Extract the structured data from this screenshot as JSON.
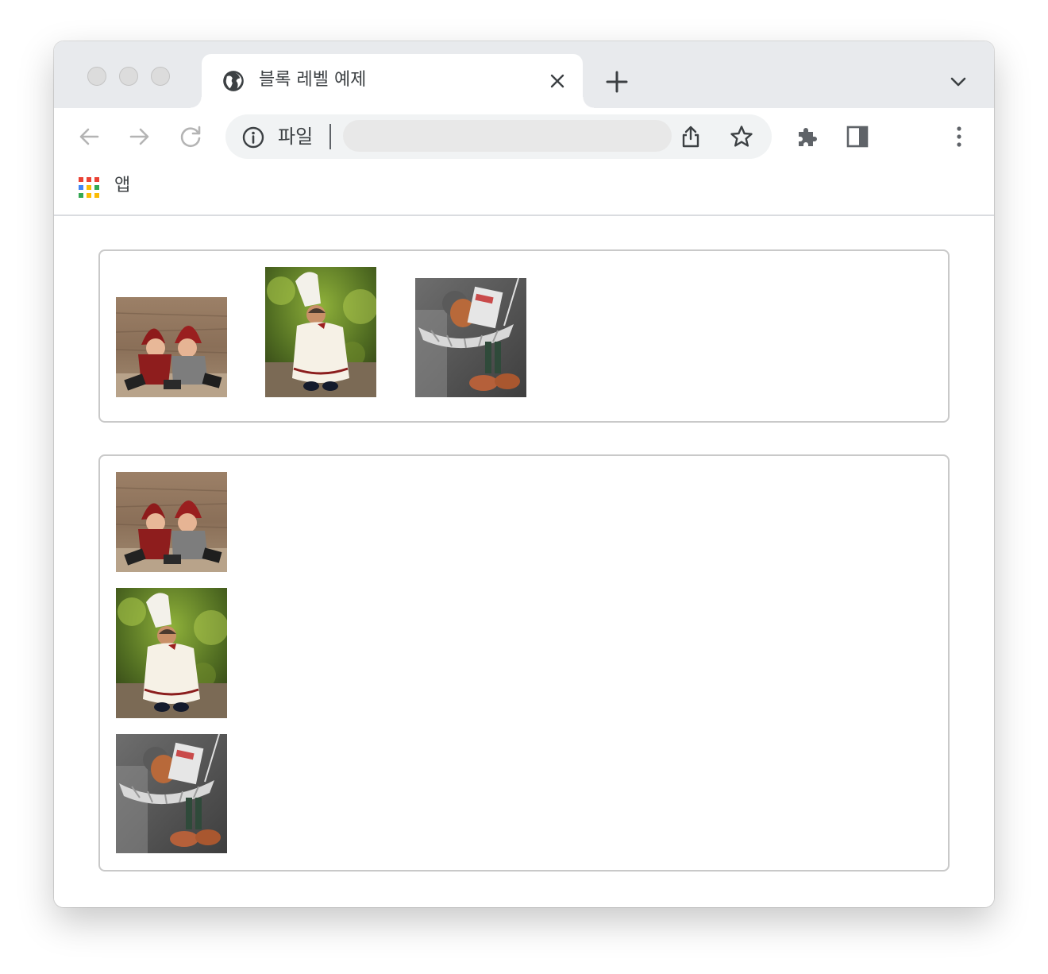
{
  "browser": {
    "tab": {
      "title": "블록 레벨 예제",
      "favicon": "globe-icon"
    },
    "address_bar": {
      "scheme_label": "파일",
      "url": ""
    },
    "bookmarks": {
      "apps_label": "앱"
    },
    "icons": {
      "back": "back-arrow-icon",
      "forward": "forward-arrow-icon",
      "reload": "reload-icon",
      "info": "info-icon",
      "share": "share-icon",
      "star": "star-icon",
      "extensions": "puzzle-icon",
      "side_panel": "side-panel-icon",
      "menu": "kebab-menu-icon",
      "new_tab": "plus-icon",
      "tab_search": "chevron-down-icon",
      "close_tab": "close-icon",
      "apps": "apps-grid-icon"
    },
    "colors": {
      "tabstrip": "#e8eaed",
      "omnibox": "#f1f3f4",
      "icon": "#5f6368",
      "icon_disabled": "#b4b4b4"
    }
  },
  "page": {
    "inline_group": {
      "images": [
        "gnome-couple",
        "chef-figurine",
        "reading-figurine"
      ]
    },
    "block_group": {
      "images": [
        "gnome-couple",
        "chef-figurine",
        "reading-figurine"
      ]
    }
  }
}
